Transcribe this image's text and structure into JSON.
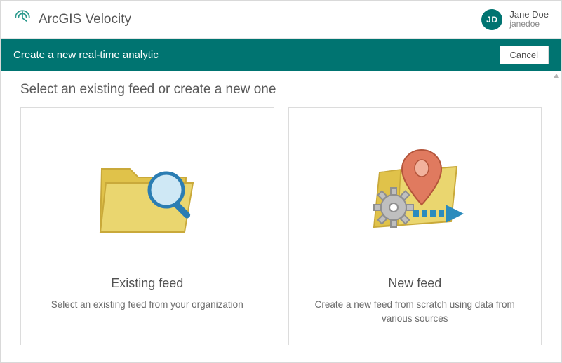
{
  "brand": {
    "title": "ArcGIS Velocity"
  },
  "user": {
    "initials": "JD",
    "display_name": "Jane Doe",
    "handle": "janedoe"
  },
  "subheader": {
    "title": "Create a new real-time analytic",
    "cancel_label": "Cancel"
  },
  "section": {
    "title": "Select an existing feed or create a new one"
  },
  "cards": {
    "existing": {
      "title": "Existing feed",
      "description": "Select an existing feed from your organization"
    },
    "newfeed": {
      "title": "New feed",
      "description": "Create a new feed from scratch using data from various sources"
    }
  }
}
